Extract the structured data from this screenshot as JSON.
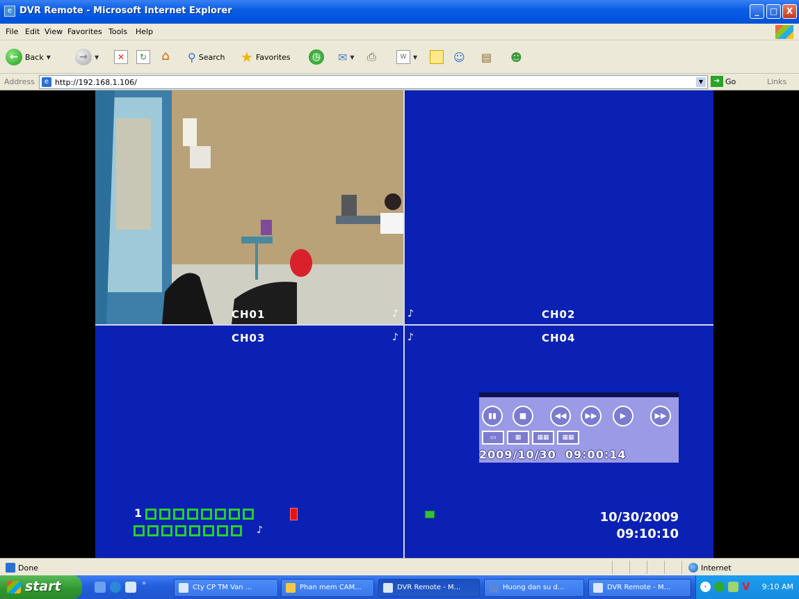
{
  "window": {
    "title": "DVR Remote - Microsoft Internet Explorer",
    "minimize": "_",
    "maximize": "□",
    "close": "X"
  },
  "menu": [
    "File",
    "Edit",
    "View",
    "Favorites",
    "Tools",
    "Help"
  ],
  "toolbar": {
    "back": "Back",
    "search": "Search",
    "favorites": "Favorites"
  },
  "address": {
    "label": "Address",
    "url": "http://192.168.1.106/",
    "go": "Go",
    "links": "Links"
  },
  "dvr": {
    "channels": [
      "CH01",
      "CH02",
      "CH03",
      "CH04"
    ],
    "playback_datetime": "2009/10/30  09:00:14",
    "channel_index_label": "1",
    "date": "10/30/2009",
    "time": "09:10:10",
    "channel_squares_row1": 8,
    "channel_squares_row2": 8
  },
  "status": {
    "text": "Done",
    "zone": "Internet"
  },
  "taskbar": {
    "start": "start",
    "tasks": [
      "Cty CP TM Van ...",
      "Phan mem CAM...",
      "DVR Remote - M...",
      "Huong dan su d...",
      "DVR Remote - M..."
    ],
    "active_task_index": 2,
    "clock": "9:10 AM"
  },
  "colors": {
    "dvr_background": "#0b21b4",
    "channel_square": "#27d127",
    "rec_indicator": "#e31414",
    "playback_panel": "#9a9ae6"
  }
}
